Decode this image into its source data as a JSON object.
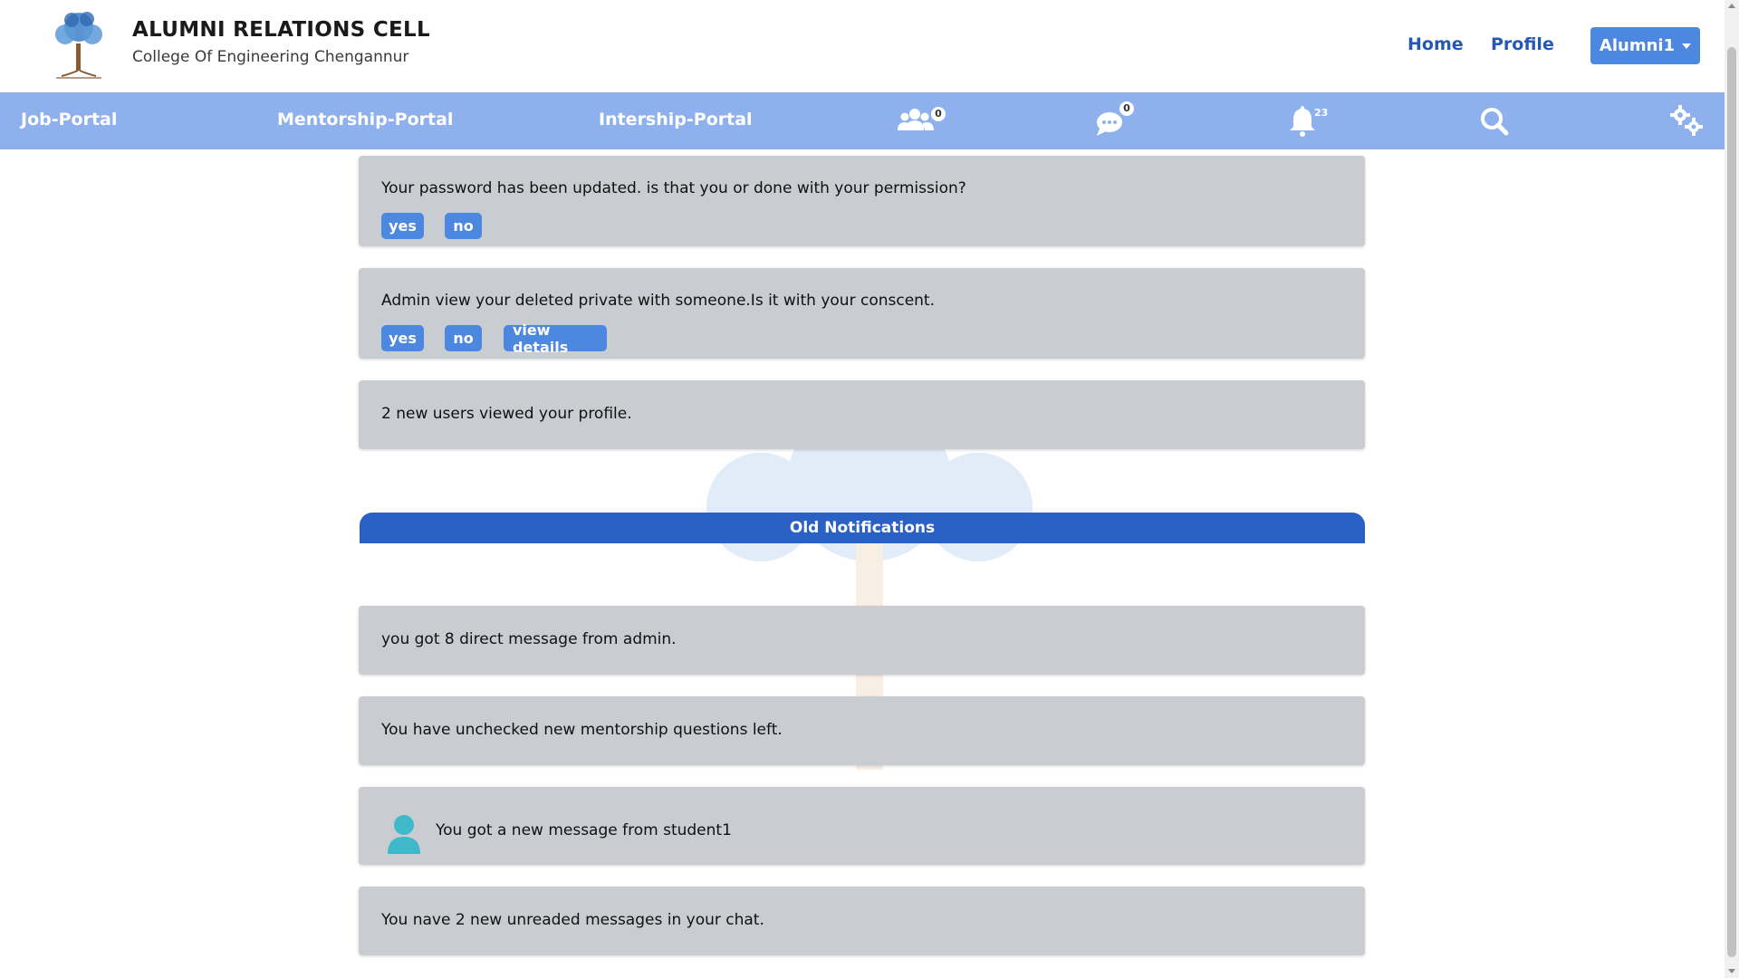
{
  "header": {
    "title": "ALUMNI RELATIONS CELL",
    "subtitle": "College Of Engineering Chengannur",
    "links": {
      "home": "Home",
      "profile": "Profile"
    },
    "user_button": "Alumni1"
  },
  "nav": {
    "job_portal": "Job-Portal",
    "mentorship_portal": "Mentorship-Portal",
    "internship_portal": "Intership-Portal",
    "connections_count": "0",
    "messages_count": "0",
    "notifications_count": "23",
    "icons": [
      "users-icon",
      "chat-icon",
      "bell-icon",
      "search-icon",
      "settings-gears-icon"
    ]
  },
  "new_notifications": [
    {
      "text": "Your password has been updated. is that you or done with your permission?",
      "actions": [
        "yes",
        "no"
      ]
    },
    {
      "text": "Admin view your deleted private with someone.Is it with your conscent.",
      "actions": [
        "yes",
        "no",
        "view details"
      ]
    },
    {
      "text": "2 new users viewed your profile."
    }
  ],
  "old_notifications_label": "Old Notifications",
  "old_notifications": [
    {
      "text": "you got 8 direct message from admin."
    },
    {
      "text": "You have unchecked new mentorship questions left."
    },
    {
      "text": "You got a new message from student1",
      "icon": "user-avatar-icon"
    },
    {
      "text": "You nave 2 new unreaded messages in your chat."
    }
  ],
  "colors": {
    "navbar": "#8eb1ee",
    "accent_button": "#4c87e0",
    "section_bar": "#2b60c4",
    "card": "#c9ccd0",
    "link": "#2557b3",
    "avatar": "#3fb8c9"
  }
}
